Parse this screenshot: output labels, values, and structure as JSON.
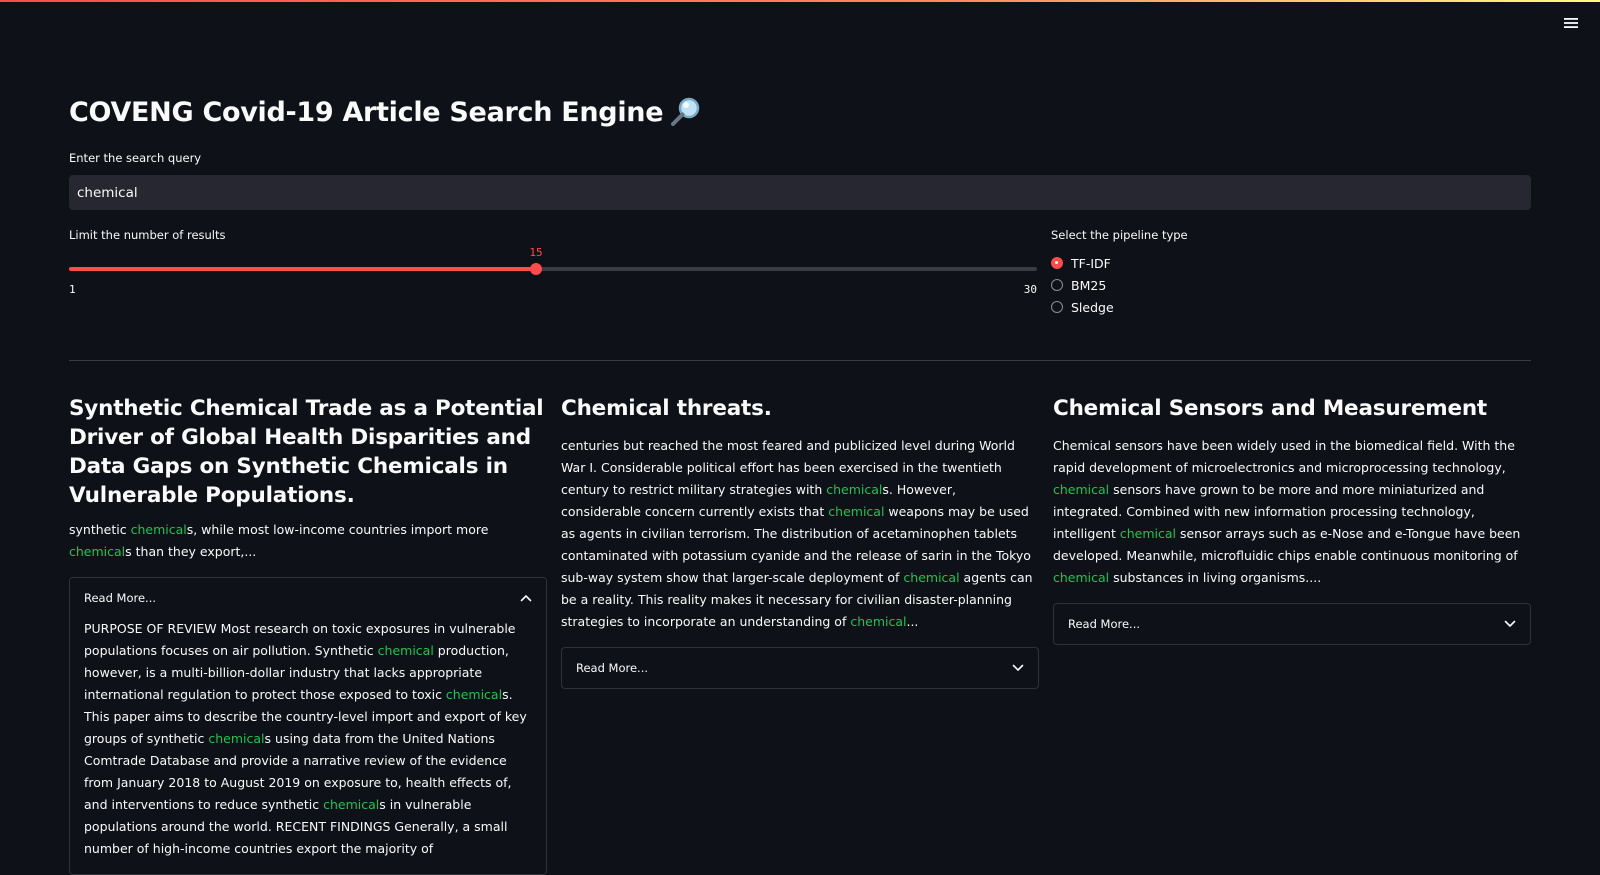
{
  "app": {
    "title": "COVENG Covid-19 Article Search Engine",
    "title_icon": "magnifier-emoji",
    "menu_icon": "hamburger-icon"
  },
  "search": {
    "label": "Enter the search query",
    "value": "chemical"
  },
  "slider": {
    "label": "Limit the number of results",
    "value": 15,
    "value_text": "15",
    "min": 1,
    "min_text": "1",
    "max": 30,
    "max_text": "30"
  },
  "pipeline": {
    "label": "Select the pipeline type",
    "options": [
      {
        "label": "TF-IDF",
        "selected": true
      },
      {
        "label": "BM25",
        "selected": false
      },
      {
        "label": "Sledge",
        "selected": false
      }
    ]
  },
  "colors": {
    "background": "#0e1117",
    "accent": "#ff4b4b",
    "highlight": "#21c354",
    "input_bg": "#262730"
  },
  "results": [
    {
      "title": "Synthetic Chemical Trade as a Potential Driver of Global Health Disparities and Data Gaps on Synthetic Chemicals in Vulnerable Populations.",
      "snippet": "synthetic <mark>chemical</mark>s, while most low-income countries import more <mark>chemical</mark>s than they export,...",
      "read_more_label": "Read More...",
      "expanded": true,
      "body": "PURPOSE OF REVIEW Most research on toxic exposures in vulnerable populations focuses on air pollution. Synthetic <mark>chemical</mark> production, however, is a multi-billion-dollar industry that lacks appropriate international regulation to protect those exposed to toxic <mark>chemical</mark>s. This paper aims to describe the country-level import and export of key groups of synthetic <mark>chemical</mark>s using data from the United Nations Comtrade Database and provide a narrative review of the evidence from January 2018 to August 2019 on exposure to, health effects of, and interventions to reduce synthetic <mark>chemical</mark>s in vulnerable populations around the world. RECENT FINDINGS Generally, a small number of high-income countries export the majority of"
    },
    {
      "title": "Chemical threats.",
      "snippet": "centuries but reached the most feared and publicized level during World War I. Considerable political effort has been exercised in the twentieth century to restrict military strategies with <mark>chemical</mark>s. However, considerable concern currently exists that <mark>chemical</mark> weapons may be used as agents in civilian terrorism. The distribution of acetaminophen tablets contaminated with potassium cyanide and the release of sarin in the Tokyo sub-way system show that larger-scale deployment of <mark>chemical</mark> agents can be a reality. This reality makes it necessary for civilian disaster-planning strategies to incorporate an understanding of <mark>chemical</mark>...",
      "read_more_label": "Read More...",
      "expanded": false,
      "body": ""
    },
    {
      "title": "Chemical Sensors and Measurement",
      "snippet": "Chemical sensors have been widely used in the biomedical field. With the rapid development of microelectronics and microprocessing technology, <mark>chemical</mark> sensors have grown to be more and more miniaturized and integrated. Combined with new information processing technology, intelligent <mark>chemical</mark> sensor arrays such as e-Nose and e-Tongue have been developed. Meanwhile, microfluidic chips enable continuous monitoring of <mark>chemical</mark> substances in living organisms....",
      "read_more_label": "Read More...",
      "expanded": false,
      "body": ""
    }
  ]
}
